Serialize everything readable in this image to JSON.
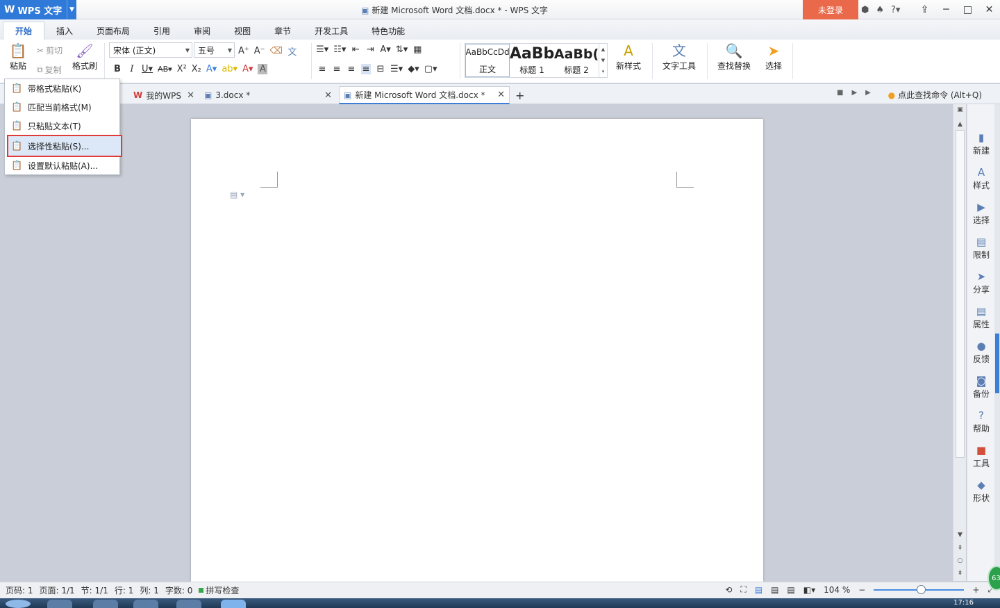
{
  "app": {
    "logo": "W",
    "name": "WPS 文字"
  },
  "window": {
    "title": "新建 Microsoft Word 文档.docx * - WPS 文字",
    "login_label": "未登录"
  },
  "menu_tabs": [
    "开始",
    "插入",
    "页面布局",
    "引用",
    "审阅",
    "视图",
    "章节",
    "开发工具",
    "特色功能"
  ],
  "ribbon": {
    "paste_label": "粘贴",
    "cut_label": "剪切",
    "copy_label": "复制",
    "format_painter_label": "格式刷",
    "font_name": "宋体 (正文)",
    "font_size": "五号",
    "styles": [
      {
        "preview": "AaBbCcDd",
        "label": "正文"
      },
      {
        "preview": "AaBb",
        "label": "标题 1"
      },
      {
        "preview": "AaBb(",
        "label": "标题 2"
      }
    ],
    "new_style_label": "新样式",
    "text_tools_label": "文字工具",
    "find_replace_label": "查找替换",
    "select_label": "选择"
  },
  "doc_tabs": [
    {
      "label": "我的WPS"
    },
    {
      "label": "3.docx *"
    },
    {
      "label": "新建 Microsoft Word 文档.docx *"
    }
  ],
  "search_cmd": "点此查找命令 (Alt+Q)",
  "paste_menu": [
    "带格式粘贴(K)",
    "匹配当前格式(M)",
    "只粘贴文本(T)",
    "选择性粘贴(S)...",
    "设置默认粘贴(A)..."
  ],
  "side_panel": [
    "新建",
    "样式",
    "选择",
    "限制",
    "分享",
    "属性",
    "反馈",
    "备份",
    "帮助",
    "工具",
    "形状"
  ],
  "status": {
    "page_code": "页码: 1",
    "pages": "页面: 1/1",
    "section": "节: 1/1",
    "row": "行: 1",
    "col": "列: 1",
    "word_count": "字数: 0",
    "spell_check": "拼写检查",
    "zoom": "104 %"
  },
  "taskbar": {
    "clock": "17:16",
    "badge": "63"
  },
  "colors": {
    "accent": "#2f7ad8",
    "login": "#e9694a",
    "highlight_border": "#e03b3b"
  }
}
